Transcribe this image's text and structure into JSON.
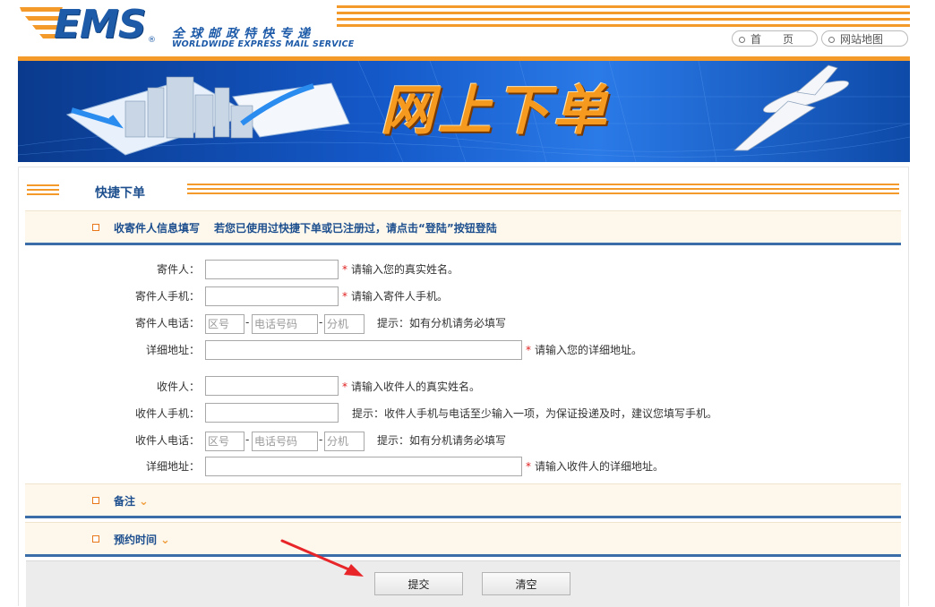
{
  "header": {
    "logo": "EMS",
    "logo_reg": "®",
    "tagline_cn": "全球邮政特快专递",
    "tagline_en": "WORLDWIDE EXPRESS MAIL SERVICE",
    "nav": [
      {
        "label": "首　　页"
      },
      {
        "label": "网站地图"
      }
    ]
  },
  "banner": {
    "title": "网上下单"
  },
  "quick_order": {
    "title": "快捷下单"
  },
  "sections": {
    "info": {
      "label": "收寄件人信息填写",
      "note": "若您已使用过快捷下单或已注册过，请点击“登陆”按钮登陆"
    },
    "remarks": {
      "label": "备注"
    },
    "appointment": {
      "label": "预约时间"
    }
  },
  "form": {
    "sender_name": {
      "label": "寄件人：",
      "hint": "请输入您的真实姓名。"
    },
    "sender_mobile": {
      "label": "寄件人手机：",
      "hint": "请输入寄件人手机。"
    },
    "sender_phone": {
      "label": "寄件人电话：",
      "area_ph": "区号",
      "number_ph": "电话号码",
      "ext_ph": "分机",
      "hint": "提示：如有分机请务必填写"
    },
    "sender_address": {
      "label": "详细地址：",
      "hint": "请输入您的详细地址。"
    },
    "receiver_name": {
      "label": "收件人：",
      "hint": "请输入收件人的真实姓名。"
    },
    "receiver_mobile": {
      "label": "收件人手机：",
      "hint": "提示：收件人手机与电话至少输入一项，为保证投递及时，建议您填写手机。"
    },
    "receiver_phone": {
      "label": "收件人电话：",
      "area_ph": "区号",
      "number_ph": "电话号码",
      "ext_ph": "分机",
      "hint": "提示：如有分机请务必填写"
    },
    "receiver_address": {
      "label": "详细地址：",
      "hint": "请输入收件人的详细地址。"
    },
    "dash": "-",
    "required_mark": "*"
  },
  "buttons": {
    "submit": "提交",
    "clear": "清空"
  },
  "colors": {
    "accent_orange": "#f39a2a",
    "brand_blue": "#1d5aa8",
    "required_red": "#e02020"
  }
}
